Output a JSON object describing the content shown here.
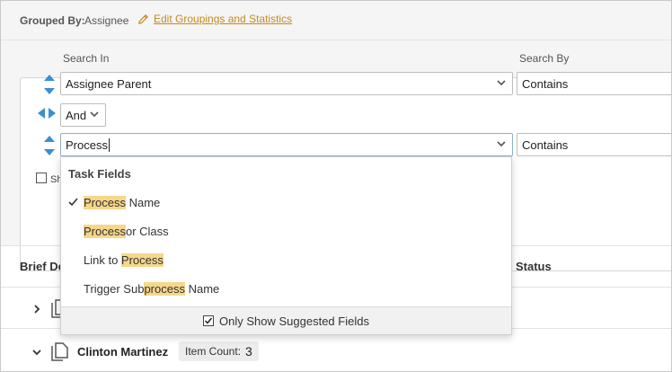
{
  "header": {
    "grouped_by_label": "Grouped By:",
    "grouped_by_value": "Assignee",
    "edit_link": "Edit Groupings and Statistics"
  },
  "search": {
    "search_in_label": "Search In",
    "search_by_label": "Search By",
    "row1": {
      "field": "Assignee Parent",
      "operator": "Contains"
    },
    "conjunction": "And",
    "row2": {
      "field": "Process",
      "operator": "Contains"
    },
    "show_checkbox_fragment": "Sh"
  },
  "dropdown": {
    "group_label": "Task Fields",
    "items": [
      {
        "parts": [
          {
            "t": "Process",
            "hl": true
          },
          {
            "t": " Name",
            "hl": false
          }
        ],
        "checked": true
      },
      {
        "parts": [
          {
            "t": "Process",
            "hl": true
          },
          {
            "t": "or Class",
            "hl": false
          }
        ],
        "checked": false
      },
      {
        "parts": [
          {
            "t": "Link to ",
            "hl": false
          },
          {
            "t": "Process",
            "hl": true
          }
        ],
        "checked": false
      },
      {
        "parts": [
          {
            "t": "Trigger Sub",
            "hl": false
          },
          {
            "t": "process",
            "hl": true
          },
          {
            "t": " Name",
            "hl": false
          }
        ],
        "checked": false
      }
    ],
    "footer_label": "Only Show Suggested Fields",
    "footer_checked": true
  },
  "table": {
    "col_brief": "Brief De",
    "col_status": "Status",
    "rows": [
      {
        "name": "",
        "expanded": false
      },
      {
        "name": "Clinton Martinez",
        "expanded": true,
        "badge_label": "Item Count:",
        "badge_value": "3"
      }
    ]
  },
  "colors": {
    "accent_link": "#c58a1a",
    "arrow_blue": "#3a8fd0",
    "highlight": "#f6d78a"
  }
}
